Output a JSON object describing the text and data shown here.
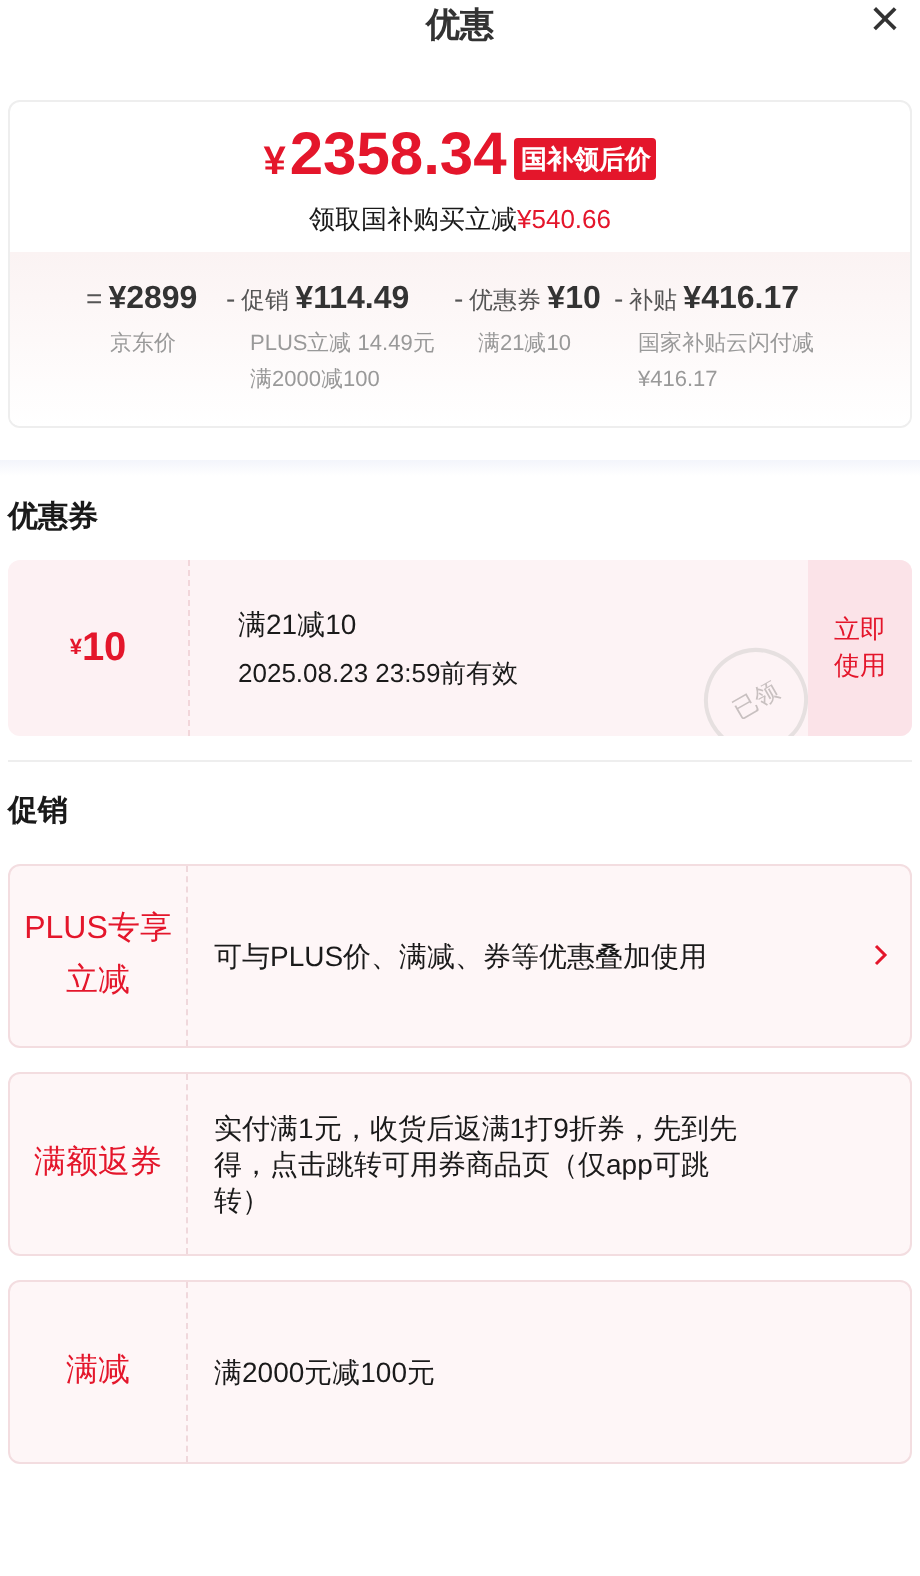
{
  "header": {
    "title": "优惠",
    "close": "×"
  },
  "price": {
    "currency": "¥",
    "value": "2358.34",
    "badge": "国补领后价",
    "subtitle": "领取国补购买立减",
    "saving": "¥540.66"
  },
  "breakdown": [
    {
      "op": "=",
      "amount": "¥2899",
      "notes": [
        "京东价"
      ]
    },
    {
      "op": "-",
      "label": "促销",
      "amount": "¥114.49",
      "notes": [
        "PLUS立减 14.49元",
        "满2000减100"
      ]
    },
    {
      "op": "-",
      "label": "优惠券",
      "amount": "¥10",
      "notes": [
        "满21减10"
      ]
    },
    {
      "op": "-",
      "label": "补贴",
      "amount": "¥416.17",
      "notes": [
        "国家补贴云闪付减",
        "¥416.17"
      ]
    }
  ],
  "coupons_section": {
    "title": "优惠券",
    "coupons": [
      {
        "currency": "¥",
        "value": "10",
        "condition": "满21减10",
        "validity": "2025.08.23 23:59前有效",
        "stamp": "已领",
        "action": "立即使用"
      }
    ]
  },
  "promotions_section": {
    "title": "促销",
    "items": [
      {
        "name": "PLUS专享立减",
        "description": "可与PLUS价、满减、券等优惠叠加使用",
        "arrow": true
      },
      {
        "name": "满额返券",
        "description": "实付满1元，收货后返满1打9折券，先到先得，点击跳转可用券商品页（仅app可跳转）",
        "arrow": false
      },
      {
        "name": "满减",
        "description": "满2000元减100元",
        "arrow": false
      }
    ]
  }
}
